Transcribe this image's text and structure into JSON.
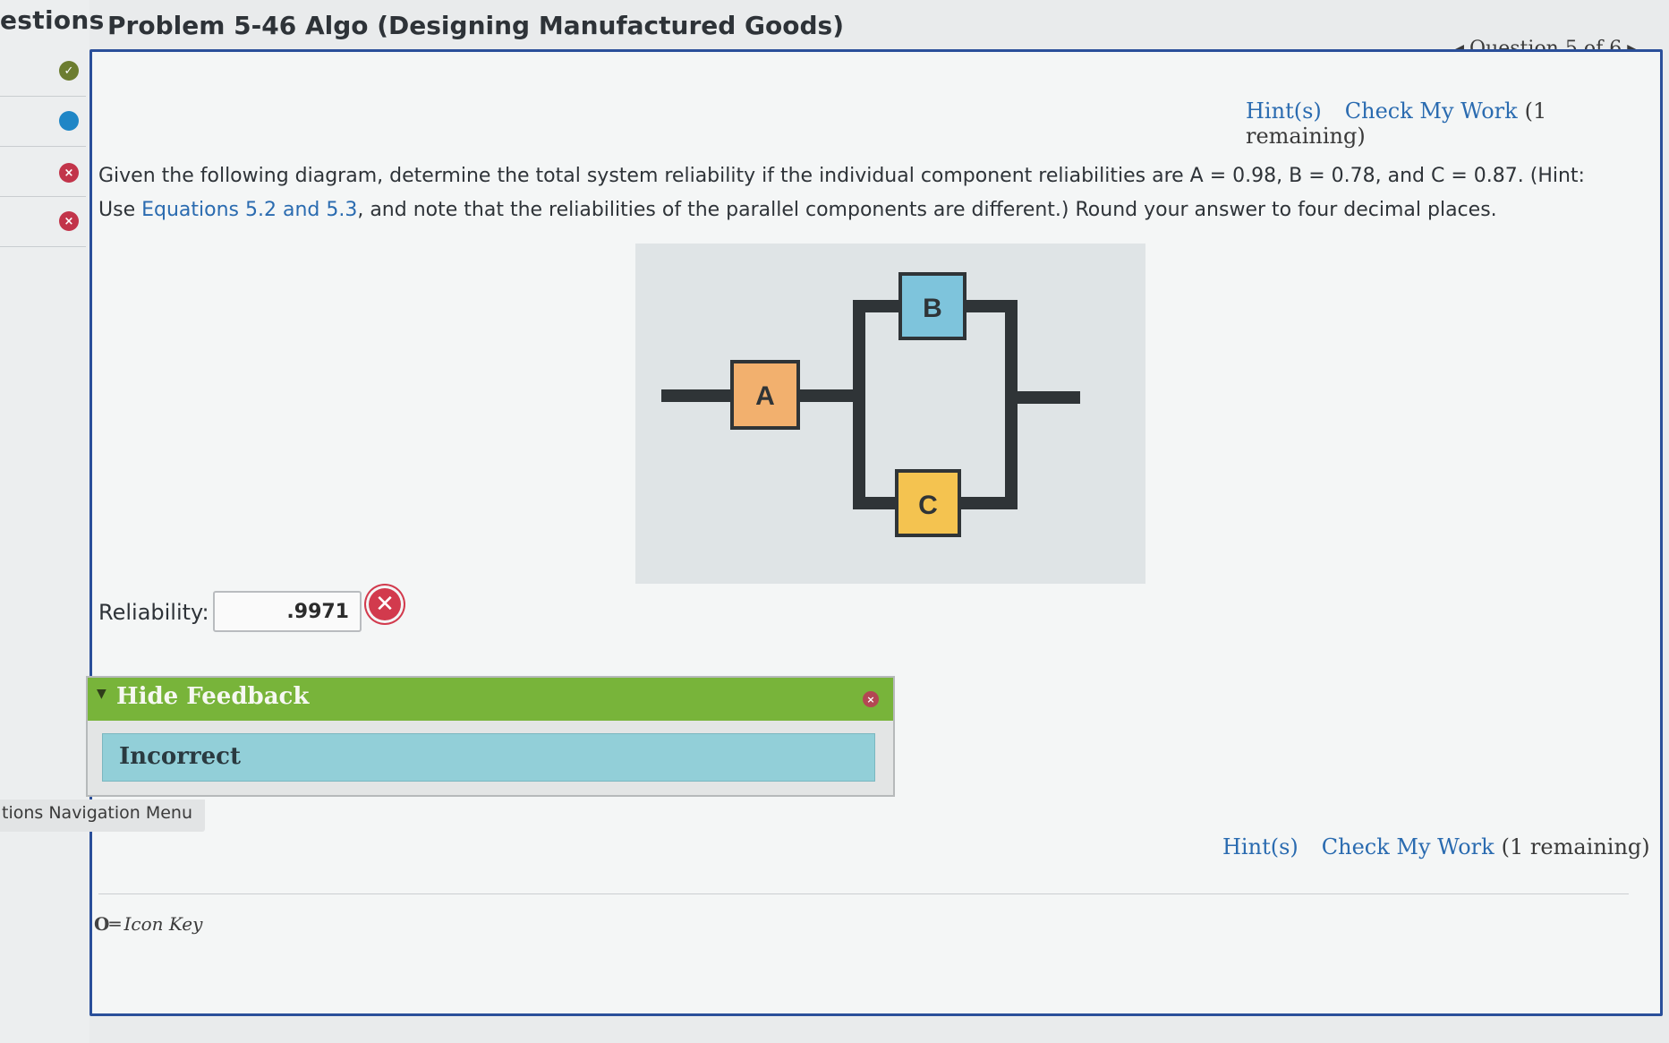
{
  "sidebar": {
    "title": "estions",
    "items": [
      {
        "status": "correct",
        "icon": "check-circle-icon",
        "glyph": "✓"
      },
      {
        "status": "current",
        "icon": "dot-icon",
        "glyph": ""
      },
      {
        "status": "incorrect",
        "icon": "x-circle-icon",
        "glyph": "×"
      },
      {
        "status": "incorrect",
        "icon": "x-circle-icon",
        "glyph": "×"
      }
    ]
  },
  "header": {
    "title": "Problem 5-46 Algo (Designing Manufactured Goods)",
    "question_nav": "Question 5 of 6",
    "prev_arrow": "◀",
    "next_arrow": "▶"
  },
  "tools_top": {
    "hints": "Hint(s)",
    "check": "Check My Work",
    "remaining": "(1 remaining)"
  },
  "tools_bottom": {
    "hints": "Hint(s)",
    "check": "Check My Work",
    "remaining": "(1 remaining)"
  },
  "question": {
    "part1": "Given the following diagram, determine the total system reliability if the individual component reliabilities are A = 0.98, B = 0.78, and C = 0.87. (Hint: Use ",
    "equations_link": "Equations 5.2 and 5.3",
    "part2": ", and note that the reliabilities of the parallel components are different.) Round your answer to four decimal places."
  },
  "diagram": {
    "components": {
      "a": "A",
      "b": "B",
      "c": "C"
    },
    "colors": {
      "a": "#f2b06e",
      "b": "#7ec4dc",
      "c": "#f4c350",
      "line": "#2f3437"
    }
  },
  "answer": {
    "label": "Reliability:",
    "value": ".9971",
    "status_icon": "x-circle-icon",
    "status_glyph": "✕"
  },
  "feedback": {
    "toggle_label": "Hide Feedback",
    "result": "Incorrect",
    "toggle_glyph": "▼",
    "close_glyph": "×"
  },
  "nav_menu": {
    "label": "tions Navigation Menu"
  },
  "icon_key": {
    "glyph": "O═",
    "label": "Icon Key"
  },
  "colors": {
    "accent": "#2a6bb0",
    "panel_border": "#2a4f9a",
    "feedback_green": "#78b43a",
    "feedback_blue": "#92cfd8",
    "error": "#d23a4d"
  }
}
